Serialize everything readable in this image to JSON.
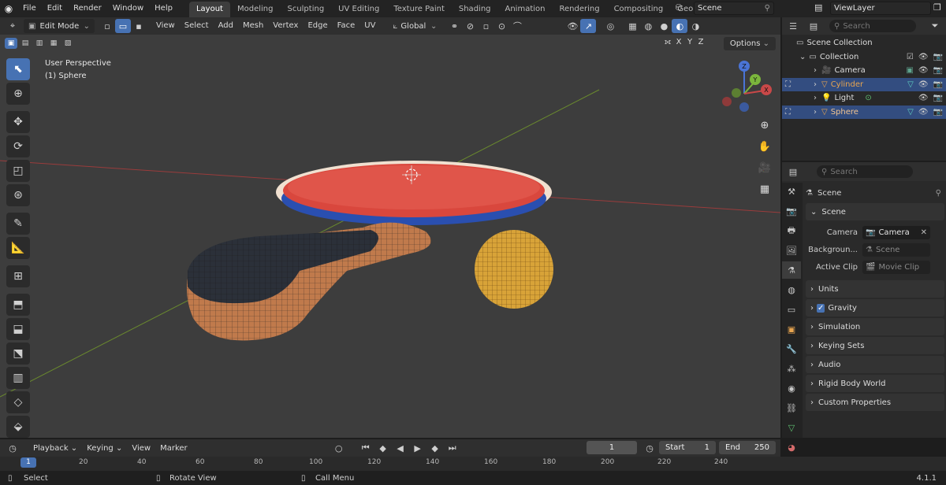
{
  "topbar": {
    "menus": [
      "File",
      "Edit",
      "Render",
      "Window",
      "Help"
    ],
    "workspaces": [
      "Layout",
      "Modeling",
      "Sculpting",
      "UV Editing",
      "Texture Paint",
      "Shading",
      "Animation",
      "Rendering",
      "Compositing",
      "Geomet"
    ],
    "scene_name": "Scene",
    "view_layer": "ViewLayer"
  },
  "viewport_header": {
    "mode": "Edit Mode",
    "menus": [
      "View",
      "Select",
      "Add",
      "Mesh",
      "Vertex",
      "Edge",
      "Face",
      "UV"
    ],
    "transform_orientation": "Global"
  },
  "viewport": {
    "view_name": "User Perspective",
    "object_name": "(1) Sphere",
    "axis_toggles": [
      "X",
      "Y",
      "Z"
    ],
    "options_label": "Options",
    "gizmo_labels": [
      "Z",
      "Y",
      "X"
    ]
  },
  "outliner": {
    "search_placeholder": "Search",
    "root": "Scene Collection",
    "collection": "Collection",
    "items": [
      {
        "name": "Camera",
        "selected": false,
        "color": "#dedede"
      },
      {
        "name": "Cylinder",
        "selected": true,
        "color": "#e8a550"
      },
      {
        "name": "Light",
        "selected": false,
        "color": "#dedede"
      },
      {
        "name": "Sphere",
        "selected": true,
        "color": "#f2c490"
      }
    ]
  },
  "properties": {
    "search_placeholder": "Search",
    "context": "Scene",
    "section_scene": "Scene",
    "camera_label": "Camera",
    "camera_value": "Camera",
    "background_label": "Backgroun...",
    "background_placeholder": "Scene",
    "active_clip_label": "Active Clip",
    "active_clip_placeholder": "Movie Clip",
    "sections": [
      "Units",
      "Gravity",
      "Simulation",
      "Keying Sets",
      "Audio",
      "Rigid Body World",
      "Custom Properties"
    ]
  },
  "timeline": {
    "menus": [
      "Playback",
      "Keying",
      "View",
      "Marker"
    ],
    "current_frame": "1",
    "start_label": "Start",
    "start_value": "1",
    "end_label": "End",
    "end_value": "250",
    "ticks": [
      "1",
      "20",
      "40",
      "60",
      "80",
      "100",
      "120",
      "140",
      "160",
      "180",
      "200",
      "220",
      "240"
    ]
  },
  "statusbar": {
    "select": "Select",
    "rotate": "Rotate View",
    "call_menu": "Call Menu",
    "version": "4.1.1"
  },
  "colors": {
    "accent": "#4772b3",
    "paddle_red": "#d9473d",
    "wood": "#c07a4c",
    "grip": "#2b3039",
    "ball": "#d8a338"
  }
}
